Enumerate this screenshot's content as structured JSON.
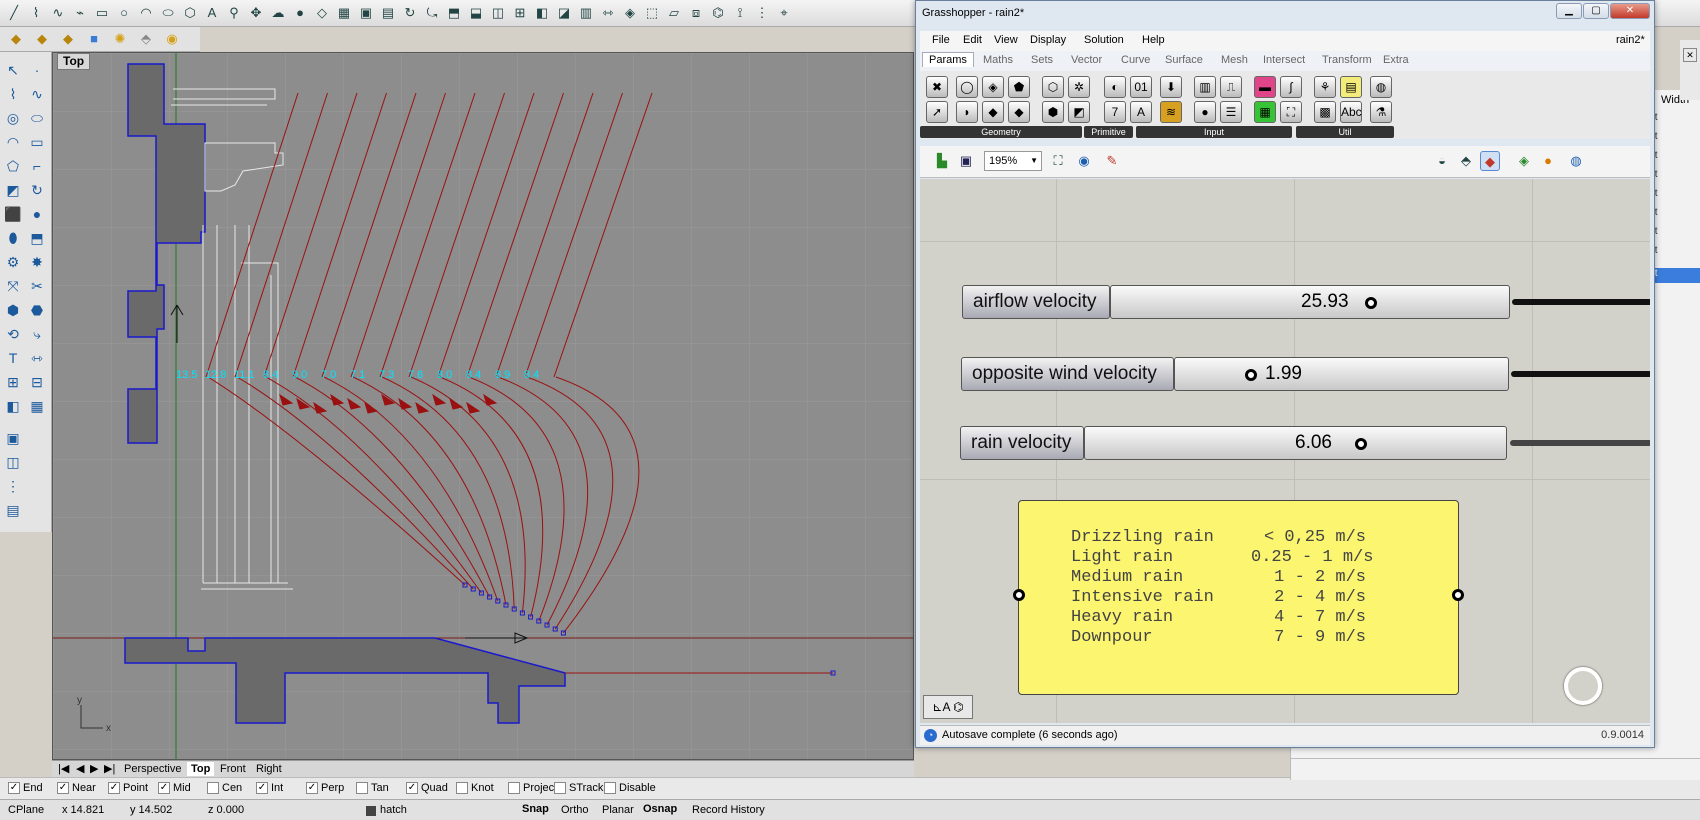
{
  "rhino": {
    "viewport_label": "Top",
    "viewport_tabs": [
      "Perspective",
      "Top",
      "Front",
      "Right"
    ],
    "active_view_tab": "Top",
    "annotations": [
      "13.5",
      "12.8",
      "11.1",
      "8.4",
      "9.0",
      "7.0",
      "7.1",
      "7.3",
      "7.6",
      "8.0",
      "8.4",
      "8.9",
      "8.4"
    ],
    "osnaps": [
      {
        "label": "End",
        "checked": true
      },
      {
        "label": "Near",
        "checked": true
      },
      {
        "label": "Point",
        "checked": true
      },
      {
        "label": "Mid",
        "checked": true
      },
      {
        "label": "Cen",
        "checked": false
      },
      {
        "label": "Int",
        "checked": true
      },
      {
        "label": "Perp",
        "checked": true
      },
      {
        "label": "Tan",
        "checked": false
      },
      {
        "label": "Quad",
        "checked": true
      },
      {
        "label": "Knot",
        "checked": false
      },
      {
        "label": "Project",
        "checked": false
      },
      {
        "label": "STrack",
        "checked": false
      },
      {
        "label": "Disable",
        "checked": false
      }
    ],
    "status": {
      "cplane": "CPlane",
      "x": "x 14.821",
      "y": "y 14.502",
      "z": "z 0.000",
      "layer": "hatch",
      "modes": [
        "Snap",
        "Ortho",
        "Planar",
        "Osnap",
        "Record History"
      ]
    },
    "properties_header": "Width",
    "properties_values": [
      "ult",
      "ult",
      "ult",
      "ult",
      "ult",
      "ult",
      "ult",
      "ult"
    ],
    "properties_selected": "ult"
  },
  "grasshopper": {
    "title": "Grasshopper - rain2*",
    "doc_name": "rain2*",
    "menu": [
      "File",
      "Edit",
      "View",
      "Display",
      "Solution",
      "Help"
    ],
    "tabs": [
      "Params",
      "Maths",
      "Sets",
      "Vector",
      "Curve",
      "Surface",
      "Mesh",
      "Intersect",
      "Transform",
      "Extra"
    ],
    "active_tab": "Params",
    "groups": [
      "Geometry",
      "Primitive",
      "Input",
      "Util"
    ],
    "zoom": "195%",
    "sliders": [
      {
        "label": "airflow velocity",
        "value": "25.93"
      },
      {
        "label": "opposite wind velocity",
        "value": "1.99"
      },
      {
        "label": "rain velocity",
        "value": "6.06"
      }
    ],
    "panel_rows": [
      {
        "label": "Drizzling rain",
        "value": "< 0,25 m/s"
      },
      {
        "label": "Light rain",
        "value": "0.25 - 1 m/s"
      },
      {
        "label": "Medium rain",
        "value": "1 - 2 m/s"
      },
      {
        "label": "Intensive rain",
        "value": "2 - 4 m/s"
      },
      {
        "label": "Heavy rain",
        "value": "4 - 7 m/s"
      },
      {
        "label": "Downpour",
        "value": "7 - 9 m/s"
      }
    ],
    "autosave_status": "Autosave complete (6 seconds ago)",
    "version": "0.9.0014"
  },
  "colors": {
    "curves": "#9a1111",
    "annotations": "#00e5ff",
    "panel": "#fbf570",
    "outline": "#1a1acc"
  }
}
